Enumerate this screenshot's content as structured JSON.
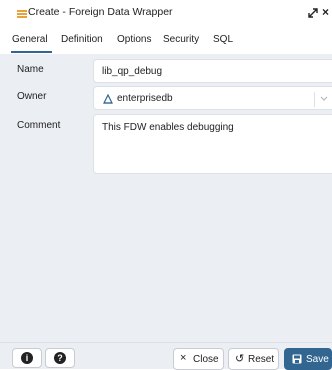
{
  "dialog": {
    "title": "Create - Foreign Data Wrapper",
    "icon": "foreign-data-wrapper-icon",
    "expand_icon": "expand-icon",
    "close_label": "×"
  },
  "tabs": [
    {
      "label": "General",
      "active": true
    },
    {
      "label": "Definition",
      "active": false
    },
    {
      "label": "Options",
      "active": false
    },
    {
      "label": "Security",
      "active": false
    },
    {
      "label": "SQL",
      "active": false
    }
  ],
  "form": {
    "name_label": "Name",
    "name_value": "lib_qp_debug",
    "owner_label": "Owner",
    "owner_value": "enterprisedb",
    "comment_label": "Comment",
    "comment_value": "This FDW enables debugging"
  },
  "footer": {
    "info_glyph": "i",
    "help_glyph": "?",
    "close_label": "Close",
    "reset_label": "Reset",
    "save_label": "Save"
  },
  "colors": {
    "accent": "#326690",
    "form_bg": "#ebeef3",
    "border": "#dde0e6"
  }
}
